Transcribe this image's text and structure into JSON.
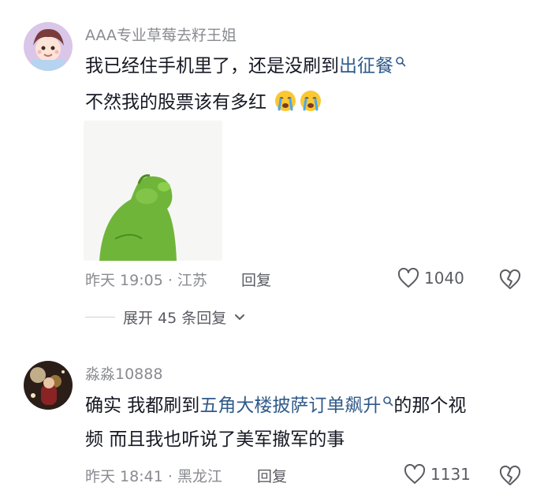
{
  "comments": [
    {
      "username": "AAA专业草莓去籽王姐",
      "text_line1_prefix": "我已经住手机里了，还是没刷到",
      "text_line1_link": "出征餐",
      "text_line2": "不然我的股票该有多红",
      "emoji": "crying-face-emoji",
      "time_location": "昨天 19:05 · 江苏",
      "reply_label": "回复",
      "like_count": "1040",
      "expand_label": "展开 45 条回复"
    },
    {
      "username": "淼淼10888",
      "text_line1_prefix": "确实 我都刷到",
      "text_line1_link": "五角大楼披萨订单飙升",
      "text_line1_suffix": "的那个视",
      "text_line2": "频 而且我也听说了美军撤军的事",
      "time_location": "昨天 18:41 · 黑龙江",
      "reply_label": "回复",
      "like_count": "1131"
    }
  ],
  "colors": {
    "text": "#161823",
    "secondary": "#8a8b91",
    "link": "#2f5a8a",
    "sticker_green": "#6fb53a"
  }
}
